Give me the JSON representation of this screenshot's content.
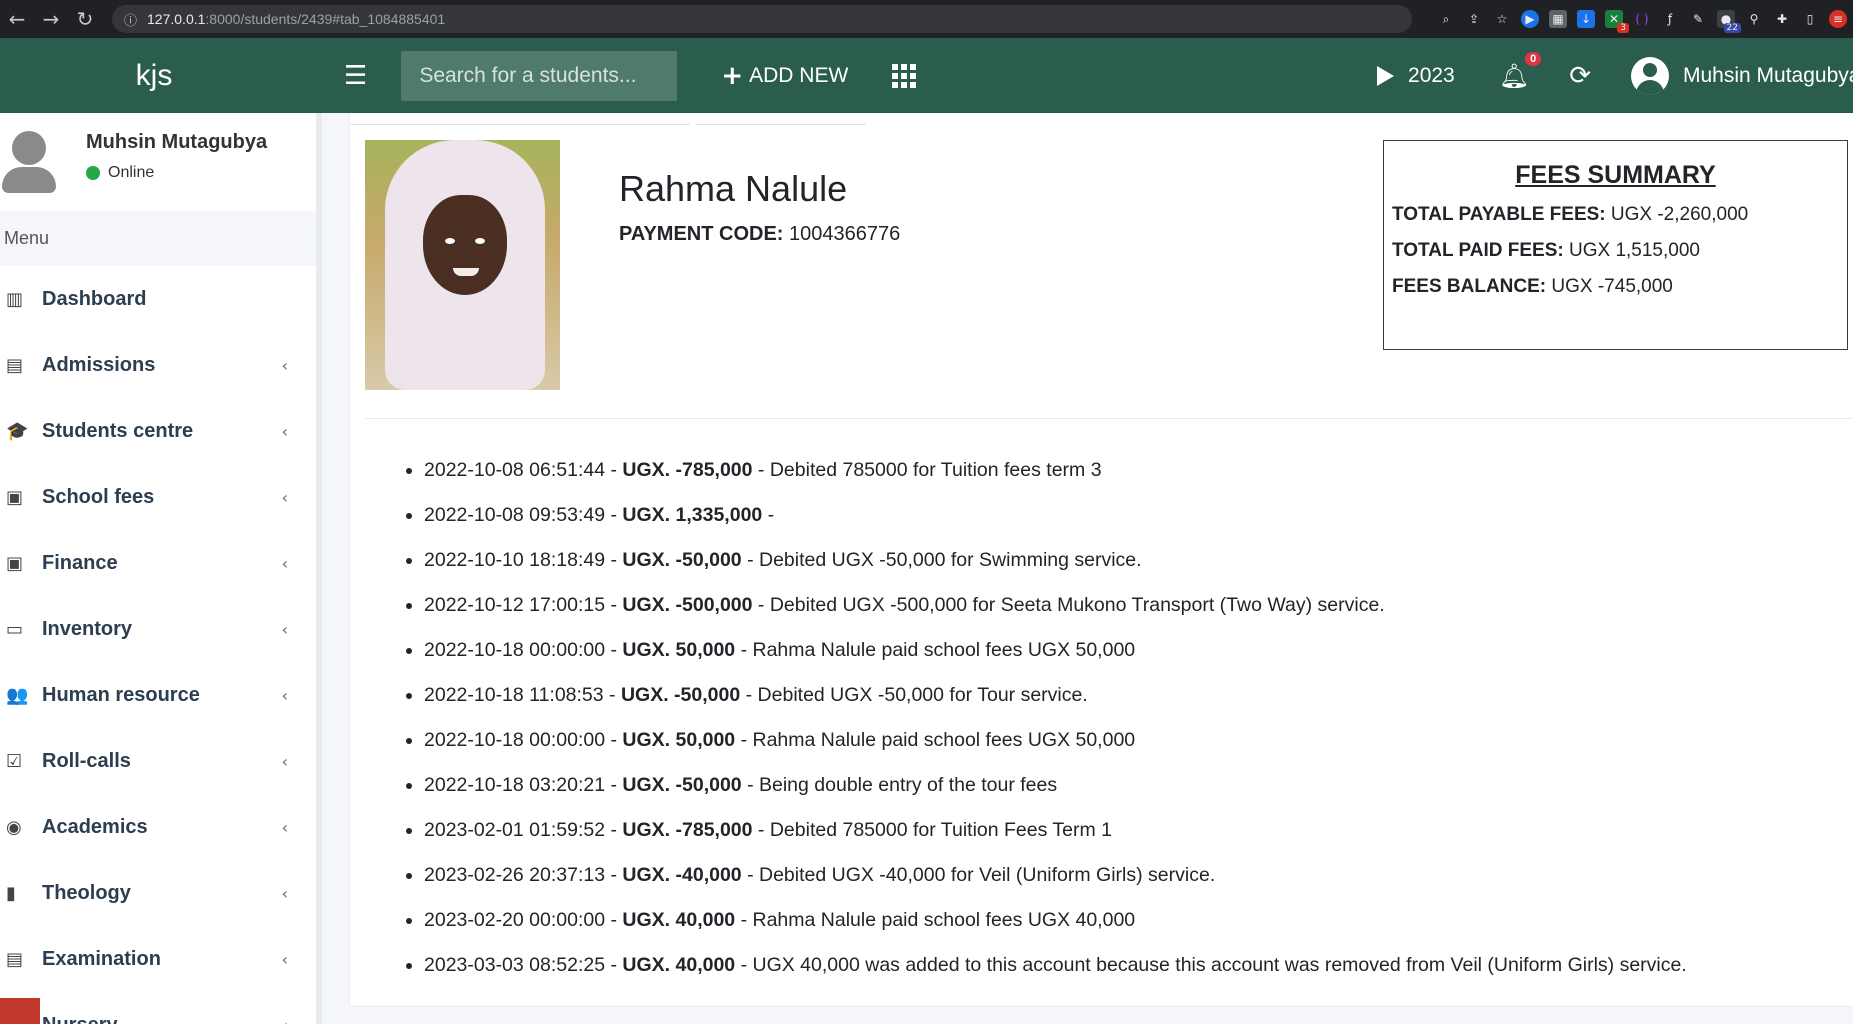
{
  "browser": {
    "url_host": "127.0.0.1",
    "url_path": ":8000/students/2439#tab_1084885401",
    "ext_badges": [
      "3",
      "22"
    ]
  },
  "header": {
    "brand": "kjs",
    "search_placeholder": "Search for a students...",
    "add_new_label": "ADD NEW",
    "year_label": "2023",
    "notification_count": "0",
    "user_name": "Muhsin Mutagubya",
    "bg_color": "#2a5d4e"
  },
  "sidebar": {
    "user_name": "Muhsin Mutagubya",
    "status": "Online",
    "menu_header": "Menu",
    "items": [
      {
        "label": "Dashboard",
        "icon": "chart-bar-icon",
        "glyph": "▥",
        "has_children": false
      },
      {
        "label": "Admissions",
        "icon": "form-icon",
        "glyph": "▤",
        "has_children": true
      },
      {
        "label": "Students centre",
        "icon": "graduation-cap-icon",
        "glyph": "🎓",
        "has_children": true
      },
      {
        "label": "School fees",
        "icon": "money-bill-icon",
        "glyph": "▣",
        "has_children": true
      },
      {
        "label": "Finance",
        "icon": "money-bill-icon",
        "glyph": "▣",
        "has_children": true
      },
      {
        "label": "Inventory",
        "icon": "inbox-icon",
        "glyph": "▭",
        "has_children": true
      },
      {
        "label": "Human resource",
        "icon": "users-icon",
        "glyph": "👥",
        "has_children": true
      },
      {
        "label": "Roll-calls",
        "icon": "check-square-icon",
        "glyph": "☑",
        "has_children": true
      },
      {
        "label": "Academics",
        "icon": "compass-icon",
        "glyph": "◉",
        "has_children": true
      },
      {
        "label": "Theology",
        "icon": "book-icon",
        "glyph": "▮",
        "has_children": true
      },
      {
        "label": "Examination",
        "icon": "form-icon",
        "glyph": "▤",
        "has_children": true
      },
      {
        "label": "Nursery",
        "icon": "box-icon",
        "glyph": "▢",
        "has_children": true
      }
    ]
  },
  "student": {
    "name": "Rahma Nalule",
    "payment_code_label": "PAYMENT CODE:",
    "payment_code": "1004366776"
  },
  "fees_summary": {
    "title": "FEES SUMMARY",
    "total_payable_label": "TOTAL PAYABLE FEES:",
    "total_payable": "UGX -2,260,000",
    "total_paid_label": "TOTAL PAID FEES:",
    "total_paid": "UGX 1,515,000",
    "balance_label": "FEES BALANCE:",
    "balance": "UGX -745,000"
  },
  "transactions": [
    {
      "date": "2022-10-08 06:51:44",
      "amount": "UGX. -785,000",
      "desc": "Debited 785000 for Tuition fees term 3"
    },
    {
      "date": "2022-10-08 09:53:49",
      "amount": "UGX. 1,335,000",
      "desc": ""
    },
    {
      "date": "2022-10-10 18:18:49",
      "amount": "UGX. -50,000",
      "desc": "Debited UGX -50,000 for Swimming service."
    },
    {
      "date": "2022-10-12 17:00:15",
      "amount": "UGX. -500,000",
      "desc": "Debited UGX -500,000 for Seeta Mukono Transport (Two Way) service."
    },
    {
      "date": "2022-10-18 00:00:00",
      "amount": "UGX. 50,000",
      "desc": "Rahma Nalule paid school fees UGX 50,000"
    },
    {
      "date": "2022-10-18 11:08:53",
      "amount": "UGX. -50,000",
      "desc": "Debited UGX -50,000 for Tour service."
    },
    {
      "date": "2022-10-18 00:00:00",
      "amount": "UGX. 50,000",
      "desc": "Rahma Nalule paid school fees UGX 50,000"
    },
    {
      "date": "2022-10-18 03:20:21",
      "amount": "UGX. -50,000",
      "desc": "Being double entry of the tour fees"
    },
    {
      "date": "2023-02-01 01:59:52",
      "amount": "UGX. -785,000",
      "desc": "Debited 785000 for Tuition Fees Term 1"
    },
    {
      "date": "2023-02-26 20:37:13",
      "amount": "UGX. -40,000",
      "desc": "Debited UGX -40,000 for Veil (Uniform Girls) service."
    },
    {
      "date": "2023-02-20 00:00:00",
      "amount": "UGX. 40,000",
      "desc": "Rahma Nalule paid school fees UGX 40,000"
    },
    {
      "date": "2023-03-03 08:52:25",
      "amount": "UGX. 40,000",
      "desc": "UGX 40,000 was added to this account because this account was removed from Veil (Uniform Girls) service."
    }
  ]
}
